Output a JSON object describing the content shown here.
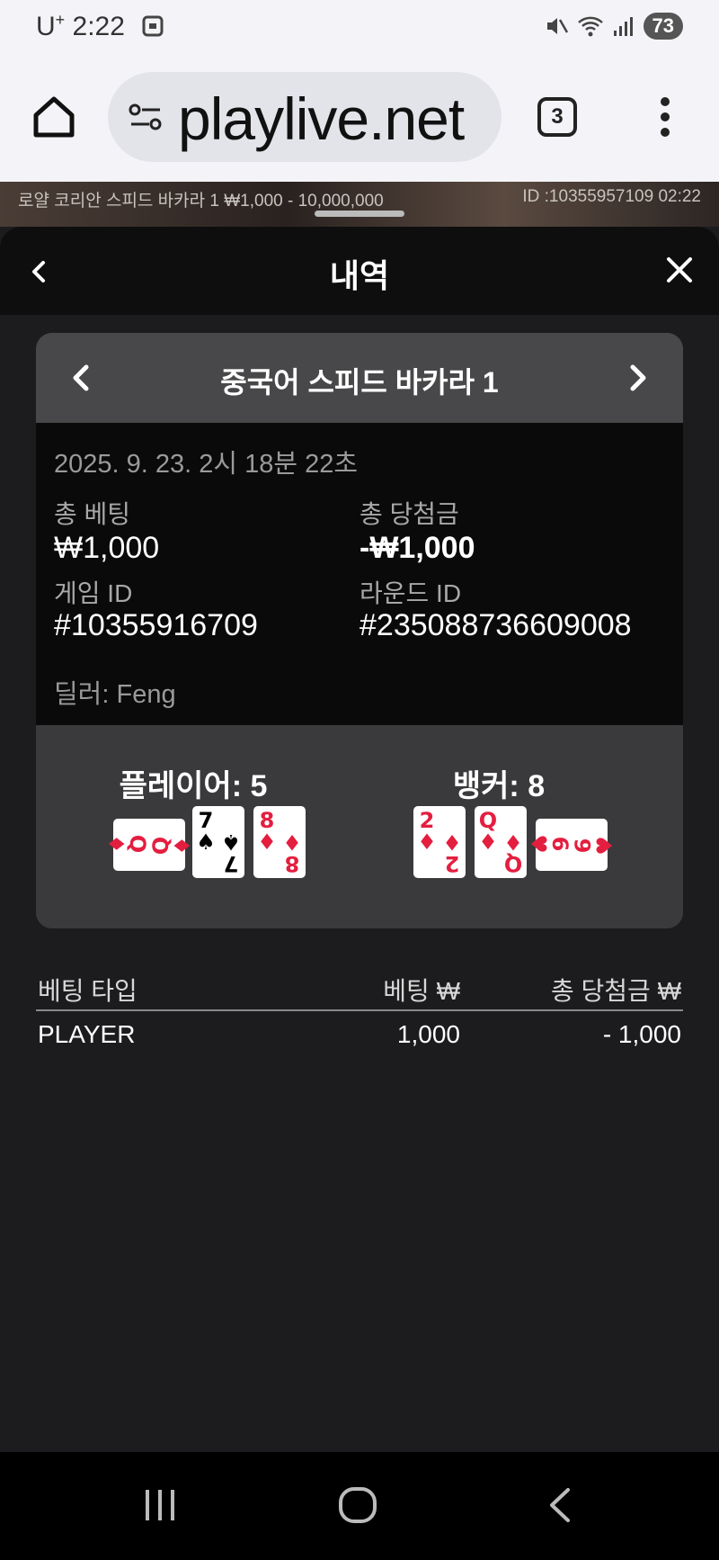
{
  "status_bar": {
    "carrier": "U",
    "carrier_sup": "+",
    "time": "2:22",
    "battery": "73"
  },
  "browser": {
    "url": "playlive.net",
    "tab_count": "3"
  },
  "video_strip": {
    "table_info": "로얄 코리안 스피드 바카라 1 ₩1,000 - 10,000,000",
    "round_info": "ID :10355957109 02:22"
  },
  "sheet": {
    "title": "내역"
  },
  "game": {
    "name": "중국어 스피드 바카라 1",
    "datetime": "2025. 9. 23. 2시 18분 22초",
    "total_bet_label": "총 베팅",
    "total_bet_value": "₩1,000",
    "total_win_label": "총 당첨금",
    "total_win_value": "-₩1,000",
    "game_id_label": "게임 ID",
    "game_id_value": "#10355916709",
    "round_id_label": "라운드 ID",
    "round_id_value": "#235088736609008",
    "dealer": "딜러: Feng"
  },
  "result": {
    "player_label": "플레이어: 5",
    "banker_label": "뱅커: 8",
    "player_cards": [
      {
        "rank": "Q",
        "suit": "♦",
        "color": "#e41e3f"
      },
      {
        "rank": "7",
        "suit": "♠",
        "color": "#000000"
      },
      {
        "rank": "8",
        "suit": "♦",
        "color": "#e41e3f"
      }
    ],
    "banker_cards": [
      {
        "rank": "2",
        "suit": "♦",
        "color": "#e41e3f"
      },
      {
        "rank": "Q",
        "suit": "♦",
        "color": "#e41e3f"
      },
      {
        "rank": "6",
        "suit": "♥",
        "color": "#e41e3f"
      }
    ]
  },
  "bets_table": {
    "headers": {
      "type": "베팅 타입",
      "bet": "베팅 ₩",
      "win": "총 당첨금 ₩"
    },
    "rows": [
      {
        "type": "PLAYER",
        "bet": "1,000",
        "win": "- 1,000"
      }
    ]
  },
  "icons": {
    "home": "home-icon",
    "tune": "site-settings-icon",
    "menu": "more-vert-icon",
    "back": "chevron-left-icon",
    "close": "close-icon",
    "prev": "chevron-left-icon",
    "next": "chevron-right-icon",
    "nav_recent": "recent-apps-icon",
    "nav_home": "home-circle-icon",
    "nav_back": "back-icon"
  }
}
